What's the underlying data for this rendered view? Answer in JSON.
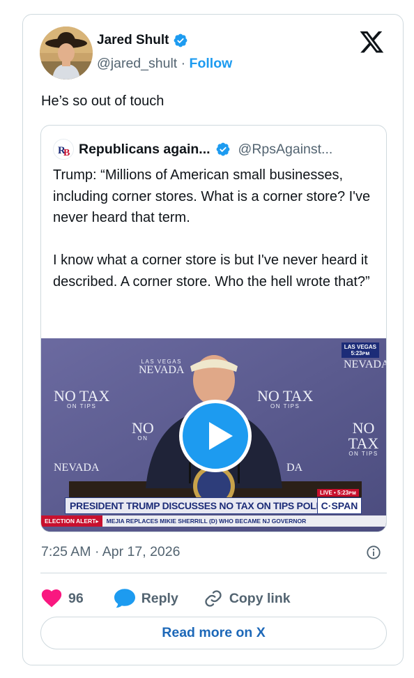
{
  "author": {
    "name": "Jared Shult",
    "handle": "@jared_shult",
    "separator": "·",
    "follow_label": "Follow"
  },
  "tweet": {
    "text": "He’s so out of touch",
    "timestamp": "7:25 AM · Apr 17, 2026"
  },
  "quoted": {
    "name": "Republicans again...",
    "handle": "@RpsAgainst...",
    "avatar_text": "RB",
    "text": "Trump: “Millions of American small businesses, including corner stores. What is a corner store? I've never heard that term.\n\nI know what a corner store is but I've never heard it described. A corner store. Who the hell wrote that?”",
    "video": {
      "location_tag_line1": "LAS VEGAS",
      "location_tag_line2": "5:23ᴘᴍ",
      "live_tag": "LIVE • 5:23ᴘᴍ",
      "banner": "PRESIDENT TRUMP DISCUSSES NO TAX ON TIPS POLICY",
      "network": "C·SPAN",
      "alert_label": "ELECTION ALERT▸",
      "ticker": "MEJIA REPLACES MIKIE SHERRILL (D) WHO BECAME NJ GOVERNOR",
      "sign_main": "NO TAX",
      "sign_sub": "ON TIPS",
      "sign_state": "NEVADA",
      "sign_state_top": "LAS VEGAS",
      "sign_partial": "NO",
      "sign_partial_sub": "ON",
      "sign_state_partial": "DA"
    }
  },
  "actions": {
    "likes": "96",
    "reply_label": "Reply",
    "copy_label": "Copy link"
  },
  "read_more_label": "Read more on X",
  "colors": {
    "accent": "#1d9bf0",
    "like": "#f91880",
    "text": "#0f1419",
    "muted": "#536471",
    "border": "#cfd9de"
  },
  "icons": [
    "verified-badge-icon",
    "x-logo-icon",
    "play-icon",
    "info-icon",
    "heart-icon",
    "reply-bubble-icon",
    "link-icon"
  ]
}
